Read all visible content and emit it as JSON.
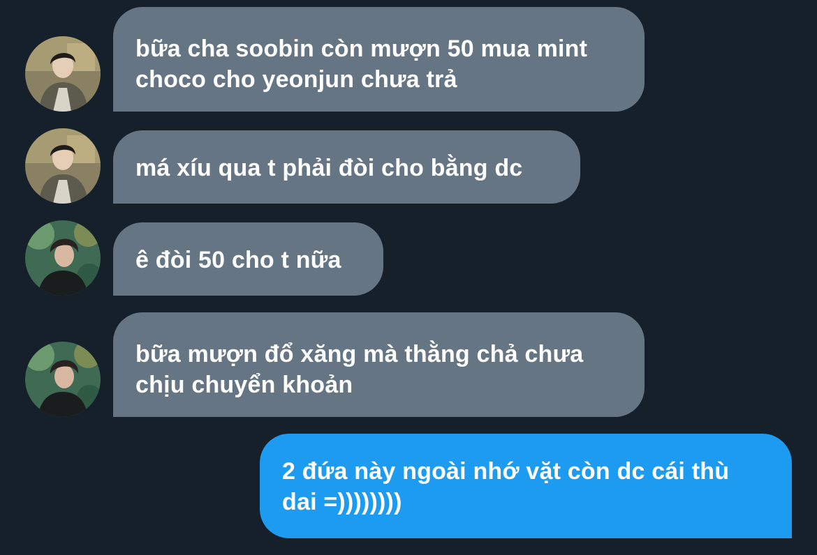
{
  "colors": {
    "background": "#16202b",
    "incoming_bubble": "#657584",
    "outgoing_bubble": "#1d9bf0",
    "text": "#ffffff"
  },
  "messages": [
    {
      "direction": "incoming",
      "sender_avatar": "avatar-a",
      "text": "bữa cha soobin còn mượn 50 mua mint choco cho yeonjun chưa trả"
    },
    {
      "direction": "incoming",
      "sender_avatar": "avatar-a",
      "text": "má xíu qua t phải đòi cho bằng dc"
    },
    {
      "direction": "incoming",
      "sender_avatar": "avatar-b",
      "text": "ê đòi 50 cho t nữa"
    },
    {
      "direction": "incoming",
      "sender_avatar": "avatar-b",
      "text": "bữa mượn đổ xăng mà thằng chả chưa chịu chuyển khoản"
    },
    {
      "direction": "outgoing",
      "text": "2 đứa này ngoài nhớ vặt còn dc cái thù dai =))))))))"
    }
  ]
}
